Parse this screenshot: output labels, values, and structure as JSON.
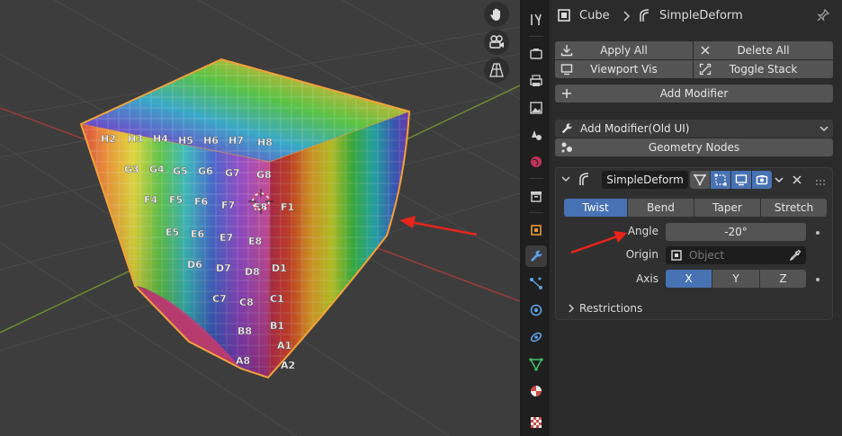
{
  "header": {
    "object_name": "Cube",
    "modifier_name": "SimpleDeform"
  },
  "actions": {
    "apply_all": "Apply All",
    "delete_all": "Delete All",
    "viewport_vis": "Viewport Vis",
    "toggle_stack": "Toggle Stack",
    "add_modifier": "Add Modifier",
    "add_modifier_old": "Add Modifier(Old UI)",
    "geometry_nodes": "Geometry Nodes"
  },
  "modifier": {
    "name": "SimpleDeform",
    "modes": [
      "Twist",
      "Bend",
      "Taper",
      "Stretch"
    ],
    "selected_mode": "Twist",
    "angle_label": "Angle",
    "angle_value": "-20°",
    "origin_label": "Origin",
    "origin_placeholder": "Object",
    "axis_label": "Axis",
    "axes": [
      "X",
      "Y",
      "Z"
    ],
    "selected_axis": "X",
    "restrictions": "Restrictions"
  },
  "cube_labels": {
    "top_row": [
      "H2",
      "H3",
      "H4",
      "H5",
      "H6",
      "H7",
      "H8"
    ],
    "column_g": [
      "G3",
      "G4",
      "G5",
      "G6",
      "G7",
      "G8"
    ],
    "column_f": [
      "F4",
      "F5",
      "F6",
      "F7",
      "F8",
      "F1"
    ],
    "column_e": [
      "E5",
      "E6",
      "E7",
      "E8"
    ],
    "column_d": [
      "D6",
      "D7",
      "D8",
      "D1"
    ],
    "column_c": [
      "C7",
      "C8",
      "C1"
    ],
    "column_b": [
      "B8",
      "B1"
    ],
    "column_a": [
      "A1",
      "A2",
      "A8"
    ]
  },
  "colors": {
    "accent": "#4772b3",
    "selection_outline": "#f2a23a",
    "annotation_arrow": "#e8241c",
    "panel_bg": "#2b2b2b",
    "button_bg": "#545454"
  }
}
